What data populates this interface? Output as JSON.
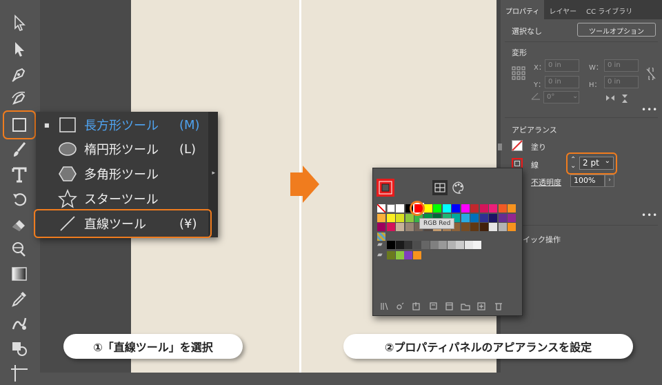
{
  "flyout": {
    "items": [
      {
        "label": "長方形ツール",
        "key": "(M)",
        "icon": "rectangle-tool-icon",
        "active": true
      },
      {
        "label": "楕円形ツール",
        "key": "(L)",
        "icon": "ellipse-tool-icon"
      },
      {
        "label": "多角形ツール",
        "key": "",
        "icon": "polygon-tool-icon"
      },
      {
        "label": "スターツール",
        "key": "",
        "icon": "star-tool-icon"
      },
      {
        "label": "直線ツール",
        "key": "(¥)",
        "icon": "line-tool-icon"
      }
    ]
  },
  "panel": {
    "tabs": [
      "プロパティ",
      "レイヤー",
      "CC ライブラリ"
    ],
    "selection": "選択なし",
    "tool_options": "ツールオプション",
    "transform_title": "変形",
    "x_label": "X：",
    "y_label": "Y：",
    "w_label": "W：",
    "h_label": "H：",
    "x_value": "0 in",
    "y_value": "0 in",
    "w_value": "0 in",
    "h_value": "0 in",
    "angle_value": "0°",
    "appearance_title": "アピアランス",
    "fill_label": "塗り",
    "stroke_label": "線",
    "stroke_value": "2 pt",
    "opacity_label": "不透明度",
    "opacity_value": "100%",
    "quick_actions": "イック操作"
  },
  "swatch_popup": {
    "tooltip": "RGB Red"
  },
  "captions": {
    "left": "①「直線ツール」を選択",
    "right": "②プロパティパネルのアピアランスを設定"
  },
  "colors": {
    "accent": "#f07c1e",
    "highlight": "#4fa3f0",
    "artboard": "#ebe4d6"
  }
}
